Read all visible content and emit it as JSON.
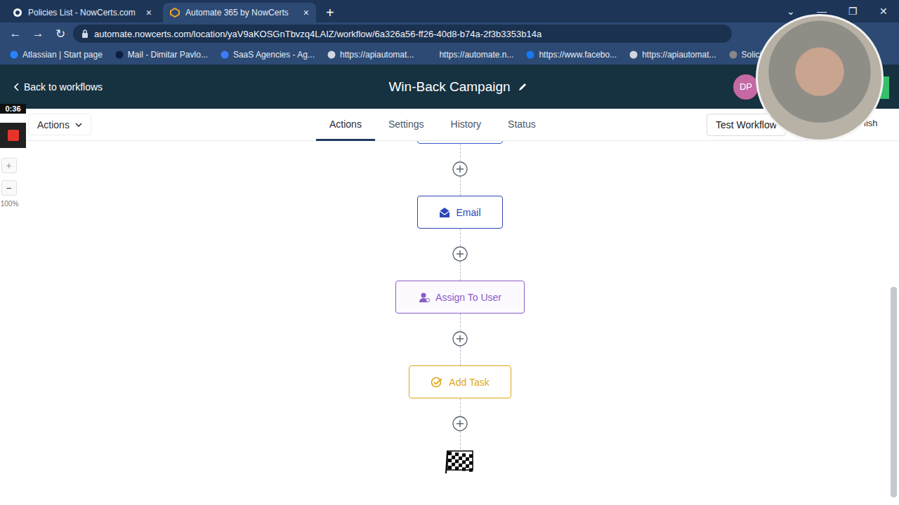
{
  "browser": {
    "tabs": [
      {
        "label": "Policies List - NowCerts.com",
        "close": "×",
        "selected": false
      },
      {
        "label": "Automate 365 by NowCerts",
        "close": "×",
        "selected": true
      }
    ],
    "new_tab": "+",
    "window_controls": [
      "⌄",
      "—",
      "❐",
      "✕"
    ],
    "nav": [
      "←",
      "→",
      "↻"
    ],
    "address": "automate.nowcerts.com/location/yaV9aKOSGnTbvzq4LAIZ/workflow/6a326a56-ff26-40d8-b74a-2f3b3353b14a",
    "bookmarks": [
      {
        "label": "Atlassian | Start page",
        "color": "#2684ff"
      },
      {
        "label": "Mail - Dimitar Pavlo...",
        "color": "#0b1f44"
      },
      {
        "label": "SaaS Agencies - Ag...",
        "color": "#3d7bff"
      },
      {
        "label": "https://apiautomat...",
        "color": "#cfd6e0"
      },
      {
        "label": "https://automate.n...",
        "color": "#2c4a74"
      },
      {
        "label": "https://www.facebo...",
        "color": "#1877f2"
      },
      {
        "label": "https://apiautomat...",
        "color": "#cfd6e0"
      },
      {
        "label": "Soliciting and",
        "color": "#888888"
      }
    ]
  },
  "header": {
    "back": "Back to workflows",
    "title": "Win-Back Campaign",
    "avatar": "DP"
  },
  "toolbar": {
    "menu": "Actions",
    "tabs": [
      {
        "label": "Actions",
        "selected": true
      },
      {
        "label": "Settings",
        "selected": false
      },
      {
        "label": "History",
        "selected": false
      },
      {
        "label": "Status",
        "selected": false
      }
    ],
    "test": "Test Workflow",
    "publish": "lish"
  },
  "recorder": {
    "time": "0:36",
    "plus": "+",
    "minus": "−",
    "zoom": "100%"
  },
  "workflow": {
    "nodes": [
      {
        "label": "Email",
        "kind": "email",
        "color": "#2e47b8"
      },
      {
        "label": "Assign To User",
        "kind": "assign",
        "color": "#8a5cc7"
      },
      {
        "label": "Add Task",
        "kind": "task",
        "color": "#e0a818"
      }
    ]
  }
}
